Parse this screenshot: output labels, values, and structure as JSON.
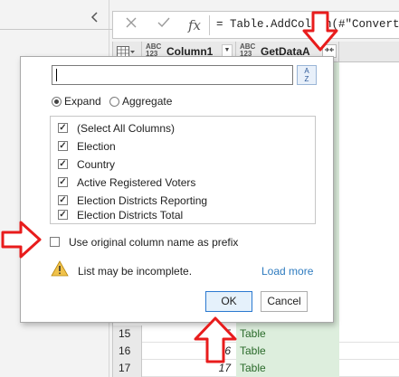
{
  "formula_bar": {
    "cancel_icon": "close-icon",
    "confirm_icon": "check-icon",
    "fx_label": "fx",
    "formula_text": "= Table.AddColumn(#\"Converted"
  },
  "grid": {
    "columns": [
      {
        "type_badge": "ABC 123",
        "name": "Column1"
      },
      {
        "type_badge": "ABC 123",
        "name": "GetDataA"
      }
    ],
    "rows": [
      {
        "row": "15",
        "value": "15",
        "table": "Table"
      },
      {
        "row": "16",
        "value": "16",
        "table": "Table"
      },
      {
        "row": "17",
        "value": "17",
        "table": "Table"
      }
    ]
  },
  "popup": {
    "search_value": "",
    "sort_icon": "sort-az-icon",
    "sort_label_top": "A",
    "sort_label_bottom": "Z",
    "options": {
      "expand": "Expand",
      "aggregate": "Aggregate",
      "selected": "expand"
    },
    "columns": [
      {
        "label": "(Select All Columns)",
        "checked": true
      },
      {
        "label": "Election",
        "checked": true
      },
      {
        "label": "Country",
        "checked": true
      },
      {
        "label": "Active Registered Voters",
        "checked": true
      },
      {
        "label": "Election Districts Reporting",
        "checked": true
      },
      {
        "label": "Election Districts Total",
        "checked": true
      }
    ],
    "prefix_label": "Use original column name as prefix",
    "prefix_checked": false,
    "warning_text": "List may be incomplete.",
    "load_more": "Load more",
    "ok": "OK",
    "cancel": "Cancel"
  },
  "colors": {
    "accent": "#2b79d0",
    "link": "#2e7bbf",
    "highlight_arrow": "#e81c1c",
    "table_cell": "#ddeedd",
    "warning": "#e6a817"
  }
}
